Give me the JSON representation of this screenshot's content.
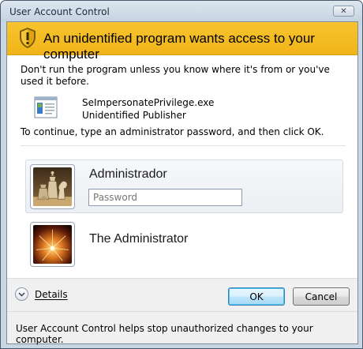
{
  "window": {
    "title": "User Account Control",
    "close_glyph": "✕"
  },
  "banner": {
    "title": "An unidentified program wants access to your computer",
    "icon": "shield-warning-icon",
    "color": "#f2b920"
  },
  "body": {
    "warning": "Don't run the program unless you know where it's from or you've used it before.",
    "program_name": "SeImpersonatePrivilege.exe",
    "publisher": "Unidentified Publisher",
    "instruction": "To continue, type an administrator password, and then click OK."
  },
  "accounts": [
    {
      "name": "Administrador",
      "avatar": "chess-pieces-avatar",
      "password_placeholder": "Password"
    },
    {
      "name": "The Administrator",
      "avatar": "fireworks-avatar"
    }
  ],
  "footer": {
    "details_label": "Details",
    "ok_label": "OK",
    "cancel_label": "Cancel",
    "info_text": "User Account Control helps stop unauthorized changes to your computer."
  }
}
